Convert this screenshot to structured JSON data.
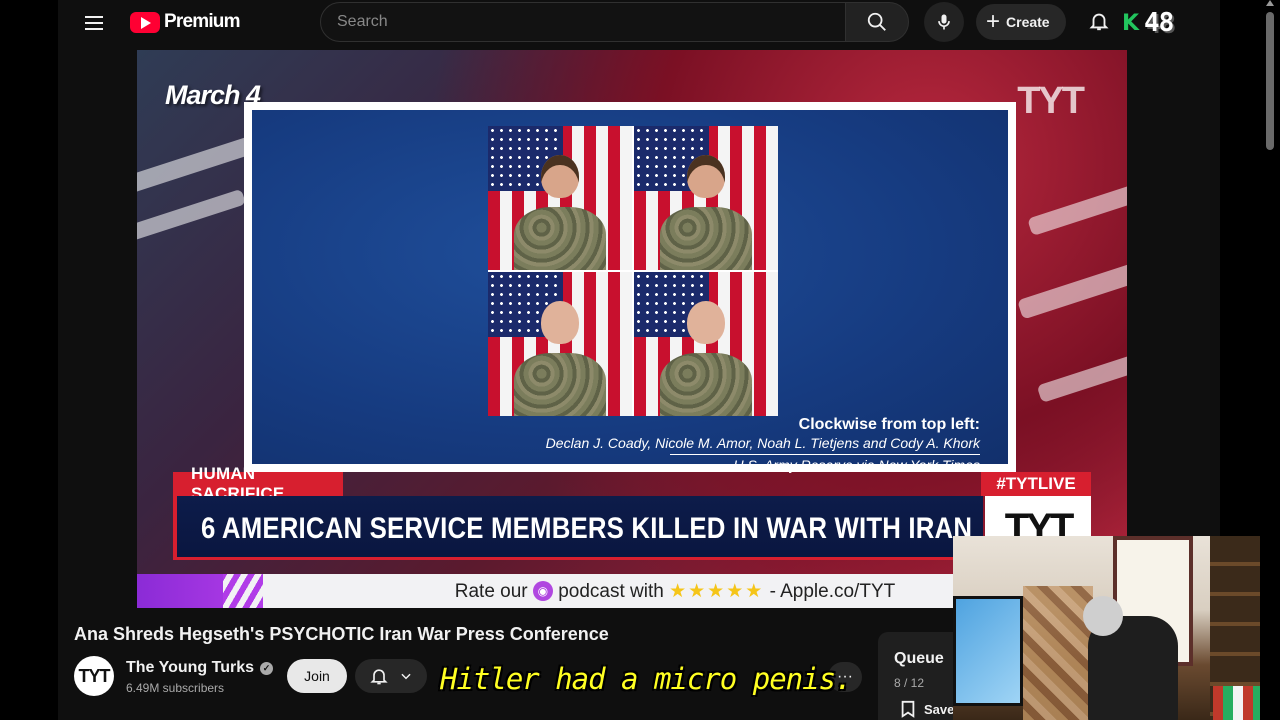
{
  "masthead": {
    "logo_text": "Premium",
    "search_placeholder": "Search",
    "create_label": "Create",
    "avatar_letter": "K",
    "avatar_badge": "48"
  },
  "video": {
    "date_label": "March 4",
    "corner_logo": "TYT",
    "caption_title": "Clockwise from top left:",
    "caption_names": "Declan J. Coady, Nicole M. Amor, Noah L. Tietjens and Cody A. Khork",
    "caption_credit": "U.S. Army Reserve via New York Times",
    "tag_left": "HUMAN SACRIFICE",
    "tag_right": "#TYTLIVE",
    "headline": "6 AMERICAN SERVICE MEMBERS KILLED IN WAR WITH IRAN",
    "logo_box": "TYT",
    "banner_before": "Rate our",
    "banner_middle": "podcast with",
    "banner_stars": "★★★★★",
    "banner_after": "- Apple.co/TYT"
  },
  "subtitle_overlay": "Hitler had a micro penis.",
  "details": {
    "title": "Ana Shreds Hegseth's PSYCHOTIC Iran War Press Conference",
    "channel_avatar": "TYT",
    "channel_name": "The Young Turks",
    "subscribers": "6.49M subscribers",
    "join_label": "Join"
  },
  "queue": {
    "title": "Queue",
    "count": "8 / 12",
    "save_label": "Save"
  }
}
